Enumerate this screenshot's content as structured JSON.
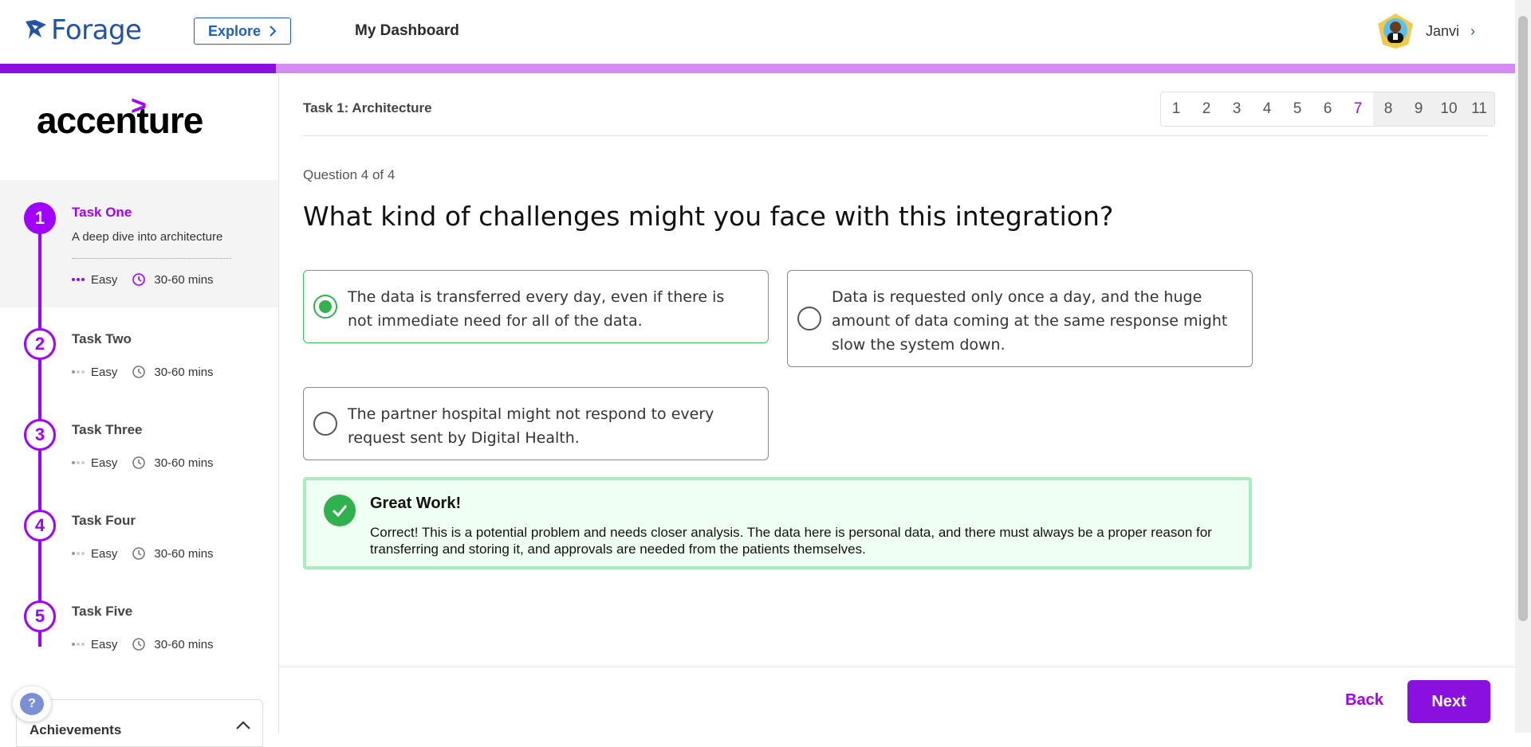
{
  "header": {
    "logo_text": "Forage",
    "explore_label": "Explore",
    "dashboard_label": "My Dashboard",
    "user_name": "Janvi"
  },
  "progress": {
    "fraction": 0.182
  },
  "sidebar": {
    "brand": "accenture",
    "tasks": [
      {
        "num": "1",
        "title": "Task One",
        "desc": "A deep dive into architecture",
        "difficulty": "Easy",
        "duration": "30-60 mins",
        "active": true
      },
      {
        "num": "2",
        "title": "Task Two",
        "difficulty": "Easy",
        "duration": "30-60 mins"
      },
      {
        "num": "3",
        "title": "Task Three",
        "difficulty": "Easy",
        "duration": "30-60 mins"
      },
      {
        "num": "4",
        "title": "Task Four",
        "difficulty": "Easy",
        "duration": "30-60 mins"
      },
      {
        "num": "5",
        "title": "Task Five",
        "difficulty": "Easy",
        "duration": "30-60 mins"
      }
    ],
    "help_label": "?",
    "achievements_label": "Achievements"
  },
  "main": {
    "task_label": "Task 1: Architecture",
    "pages": [
      "1",
      "2",
      "3",
      "4",
      "5",
      "6",
      "7",
      "8",
      "9",
      "10",
      "11"
    ],
    "current_page": "7",
    "question_count": "Question 4 of 4",
    "question": "What kind of challenges might you face with this integration?",
    "options": [
      "The data is transferred every day, even if there is not immediate need for all of the data.",
      "Data is requested only once a day, and the huge amount of data coming at the same response might slow the system down.",
      "The partner hospital might not respond to every request sent by Digital Health."
    ],
    "feedback": {
      "title": "Great Work!",
      "text": "Correct! This is a potential problem and needs closer analysis. The data here is personal data, and there must always be a proper reason for transferring and storing it, and approvals are needed from the patients themselves."
    }
  },
  "footer": {
    "back_label": "Back",
    "next_label": "Next"
  },
  "colors": {
    "accent": "#a100ff",
    "brand_blue": "#2353a8",
    "success": "#2fb14e"
  }
}
